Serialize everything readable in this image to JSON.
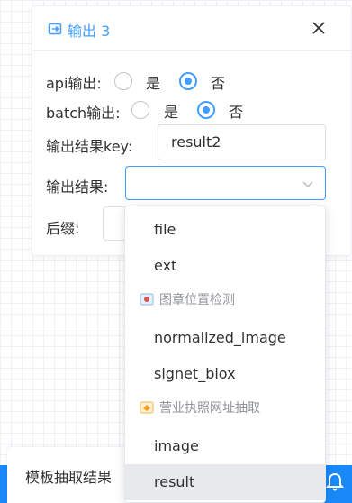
{
  "panel": {
    "title": "输出 3",
    "icon": "output-icon",
    "close_icon": "close-icon"
  },
  "form": {
    "api_output": {
      "label": "api输出:",
      "options": [
        "是",
        "否"
      ],
      "selected": "否"
    },
    "batch_output": {
      "label": "batch输出:",
      "options": [
        "是",
        "否"
      ],
      "selected": "否"
    },
    "result_key": {
      "label": "输出结果key:",
      "value": "result2"
    },
    "result": {
      "label": "输出结果:",
      "value": ""
    },
    "suffix": {
      "label": "后缀:"
    }
  },
  "dropdown": {
    "items": [
      {
        "type": "option",
        "label": "file"
      },
      {
        "type": "option",
        "label": "ext"
      },
      {
        "type": "group",
        "label": "图章位置检测",
        "icon": "stamp-detection-icon"
      },
      {
        "type": "option",
        "label": "normalized_image"
      },
      {
        "type": "option",
        "label": "signet_blox"
      },
      {
        "type": "group",
        "label": "营业执照网址抽取",
        "icon": "license-extract-icon"
      },
      {
        "type": "option",
        "label": "image"
      },
      {
        "type": "option",
        "label": "result",
        "hovered": true
      }
    ]
  },
  "bottom_bar": {
    "tab_label": "模板抽取结果",
    "bell_icon": "bell-icon"
  },
  "colors": {
    "accent": "#409eff",
    "blue_bar": "#1989fa"
  }
}
